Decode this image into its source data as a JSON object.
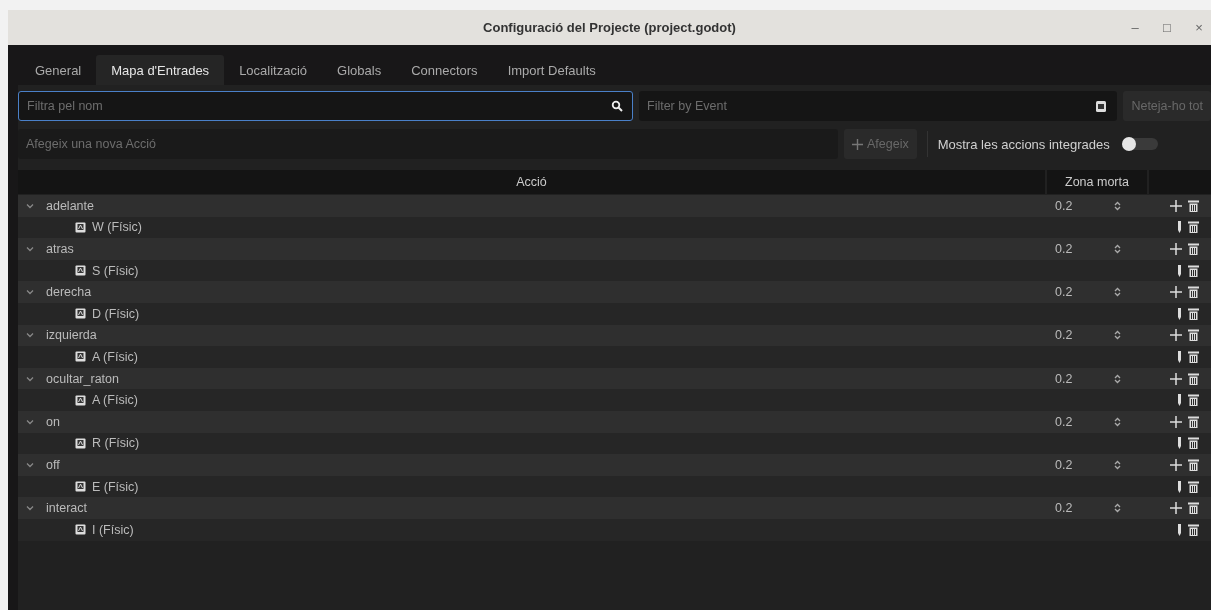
{
  "window": {
    "title": "Configuració del Projecte (project.godot)",
    "controls": [
      "–",
      "□",
      "×"
    ]
  },
  "tabs": [
    {
      "label": "General",
      "selected": false
    },
    {
      "label": "Mapa d'Entrades",
      "selected": true
    },
    {
      "label": "Localització",
      "selected": false
    },
    {
      "label": "Globals",
      "selected": false
    },
    {
      "label": "Connectors",
      "selected": false
    },
    {
      "label": "Import Defaults",
      "selected": false
    }
  ],
  "filter": {
    "placeholder": "Filtra pel nom"
  },
  "event_filter": {
    "placeholder": "Filter by Event"
  },
  "clear_button": "Neteja-ho tot",
  "new_action": {
    "placeholder": "Afegeix una nova Acció"
  },
  "add_button": "Afegeix",
  "builtin_toggle": {
    "label": "Mostra les accions integrades",
    "on": false
  },
  "table": {
    "columns": [
      "Acció",
      "Zona morta"
    ],
    "rows": [
      {
        "name": "adelante",
        "expanded": true,
        "deadzone": "0.2",
        "children": [
          {
            "event": "W (Físic)"
          }
        ]
      },
      {
        "name": "atras",
        "expanded": true,
        "deadzone": "0.2",
        "children": [
          {
            "event": "S (Físic)"
          }
        ]
      },
      {
        "name": "derecha",
        "expanded": true,
        "deadzone": "0.2",
        "children": [
          {
            "event": "D (Físic)"
          }
        ]
      },
      {
        "name": "izquierda",
        "expanded": true,
        "deadzone": "0.2",
        "children": [
          {
            "event": "A (Físic)"
          }
        ]
      },
      {
        "name": "ocultar_raton",
        "expanded": true,
        "deadzone": "0.2",
        "children": [
          {
            "event": "A (Físic)"
          }
        ]
      },
      {
        "name": "on",
        "expanded": true,
        "deadzone": "0.2",
        "children": [
          {
            "event": "R (Físic)"
          }
        ]
      },
      {
        "name": "off",
        "expanded": true,
        "deadzone": "0.2",
        "children": [
          {
            "event": "E (Físic)"
          }
        ]
      },
      {
        "name": "interact",
        "expanded": true,
        "deadzone": "0.2",
        "children": [
          {
            "event": "I (Físic)"
          }
        ]
      }
    ]
  }
}
